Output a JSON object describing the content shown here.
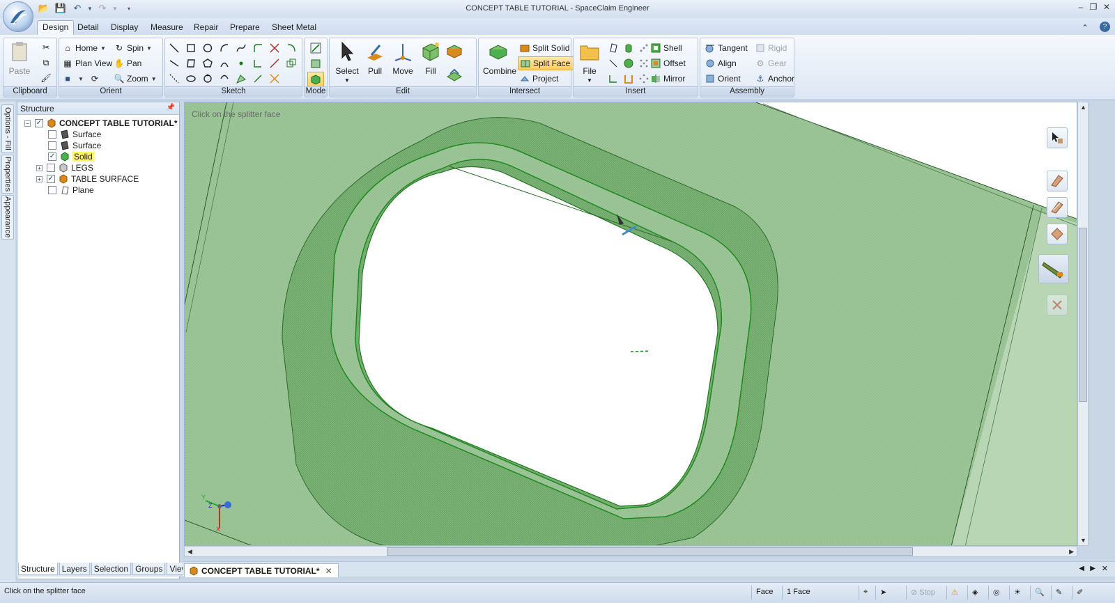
{
  "window": {
    "title": "CONCEPT TABLE TUTORIAL - SpaceClaim Engineer"
  },
  "ribbon_tabs": [
    "Design",
    "Detail",
    "Display",
    "Measure",
    "Repair",
    "Prepare",
    "Sheet Metal"
  ],
  "active_tab": "Design",
  "groups": {
    "clipboard": {
      "label": "Clipboard",
      "paste": "Paste"
    },
    "orient": {
      "label": "Orient",
      "home": "Home",
      "plan_view": "Plan View",
      "spin": "Spin",
      "pan": "Pan",
      "zoom": "Zoom"
    },
    "sketch": {
      "label": "Sketch"
    },
    "mode": {
      "label": "Mode"
    },
    "edit": {
      "label": "Edit",
      "select": "Select",
      "pull": "Pull",
      "move": "Move",
      "fill": "Fill"
    },
    "intersect": {
      "label": "Intersect",
      "combine": "Combine",
      "split_solid": "Split Solid",
      "split_face": "Split Face",
      "project": "Project"
    },
    "insert": {
      "label": "Insert",
      "file": "File",
      "shell": "Shell",
      "offset": "Offset",
      "mirror": "Mirror"
    },
    "assembly": {
      "label": "Assembly",
      "tangent": "Tangent",
      "align": "Align",
      "orient": "Orient",
      "rigid": "Rigid",
      "gear": "Gear",
      "anchor": "Anchor"
    }
  },
  "side_tabs": [
    "Options - Fill",
    "Properties",
    "Appearance"
  ],
  "structure": {
    "title": "Structure",
    "root": "CONCEPT TABLE TUTORIAL*",
    "items": [
      {
        "label": "Surface",
        "checked": false
      },
      {
        "label": "Surface",
        "checked": false
      },
      {
        "label": "Solid",
        "checked": true,
        "selected": true
      },
      {
        "label": "LEGS",
        "checked": false,
        "expandable": true
      },
      {
        "label": "TABLE SURFACE",
        "checked": true,
        "expandable": true
      },
      {
        "label": "Plane",
        "checked": false
      }
    ]
  },
  "panel_tabs": [
    "Structure",
    "Layers",
    "Selection",
    "Groups",
    "Views"
  ],
  "viewport": {
    "hint": "Click on the splitter face",
    "face_color": "#9fc79c",
    "edge_color": "#1e8a1e",
    "axis_labels": {
      "y": "Y",
      "z": "Z",
      "x": "X"
    }
  },
  "document_tab": "CONCEPT TABLE TUTORIAL*",
  "status": {
    "message": "Click on the splitter face",
    "mode": "Face",
    "selection": "1 Face",
    "stop": "Stop"
  }
}
